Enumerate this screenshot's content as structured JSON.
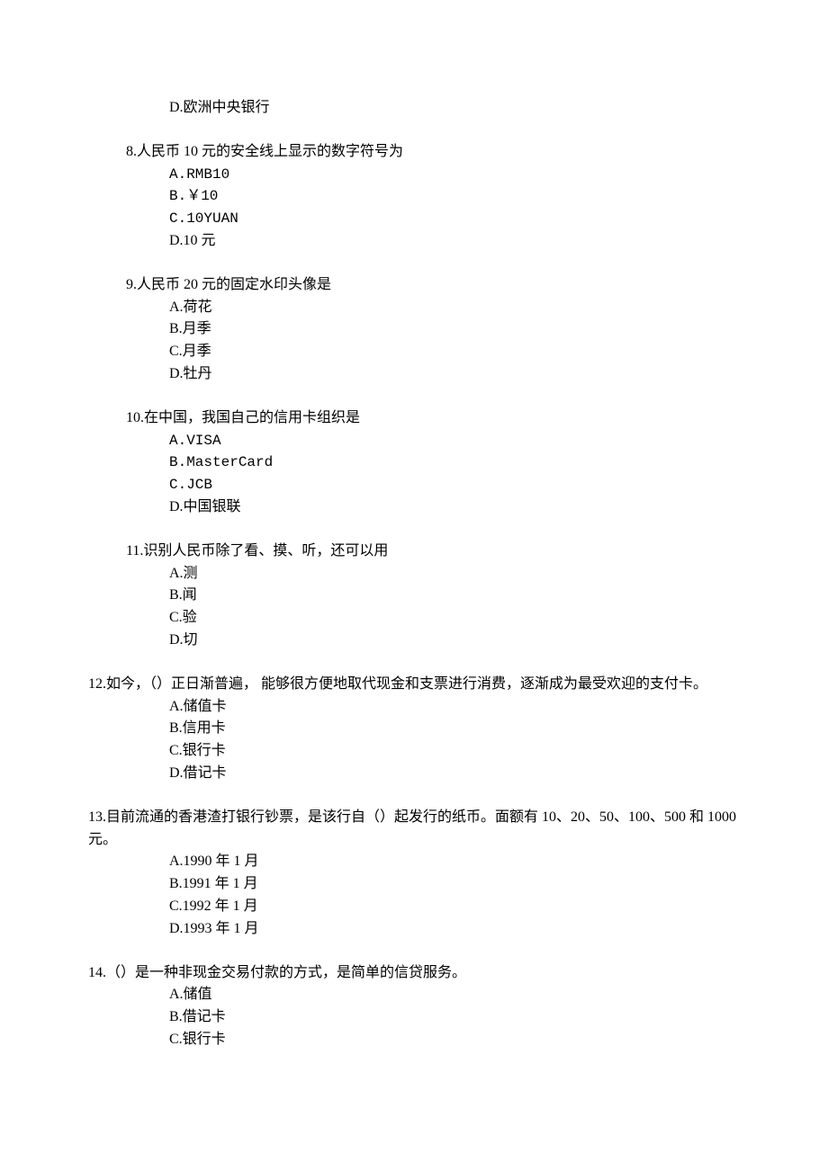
{
  "orphan": {
    "d": "D.欧洲中央银行"
  },
  "questions": [
    {
      "num": "8",
      "stem": "8.人民币 10 元的安全线上显示的数字符号为",
      "opts": [
        "A.RMB10",
        "B.￥10",
        "C.10YUAN",
        "D.10 元"
      ]
    },
    {
      "num": "9",
      "stem": "9.人民币 20 元的固定水印头像是",
      "opts": [
        "A.荷花",
        "B.月季",
        "C.月季",
        "D.牡丹"
      ]
    },
    {
      "num": "10",
      "stem": "10.在中国，我国自己的信用卡组织是",
      "opts": [
        "A.VISA",
        "B.MasterCard",
        "C.JCB",
        "D.中国银联"
      ]
    },
    {
      "num": "11",
      "stem": "11.识别人民币除了看、摸、听，还可以用",
      "opts": [
        "A.测",
        "B.闻",
        "C.验",
        "D.切"
      ]
    },
    {
      "num": "12",
      "stem": " 12.如今，（）正日渐普遍， 能够很方便地取代现金和支票进行消费，逐渐成为最受欢迎的支付卡。",
      "opts": [
        "A.储值卡",
        "B.信用卡",
        "C.银行卡",
        "D.借记卡"
      ]
    },
    {
      "num": "13",
      "stem": " 13.目前流通的香港渣打银行钞票，是该行自（）起发行的纸币。面额有 10、20、50、100、500 和 1000 元。",
      "opts": [
        "A.1990 年 1 月",
        "B.1991 年 1 月",
        "C.1992 年 1 月",
        "D.1993 年 1 月"
      ]
    },
    {
      "num": "14",
      "stem": " 14.（）是一种非现金交易付款的方式，是简单的信贷服务。",
      "opts": [
        "A.储值",
        "B.借记卡",
        "C.银行卡"
      ]
    }
  ]
}
